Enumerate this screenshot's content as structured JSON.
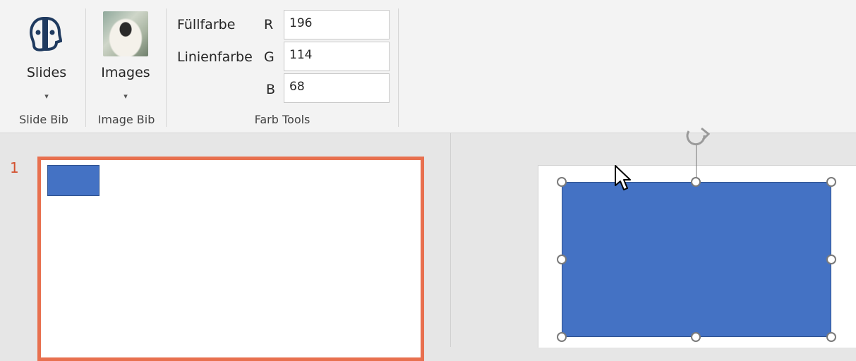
{
  "ribbon": {
    "slides_button": {
      "label": "Slides",
      "caret": "▾"
    },
    "images_button": {
      "label": "Images",
      "caret": "▾"
    },
    "groups": {
      "slide_bib": "Slide Bib",
      "image_bib": "Image Bib",
      "farb_tools": "Farb Tools"
    },
    "farb": {
      "fill_label": "Füllfarbe",
      "line_label": "Linienfarbe",
      "r_label": "R",
      "g_label": "G",
      "b_label": "B",
      "r_value": "196",
      "g_value": "114",
      "b_value": "68"
    }
  },
  "thumbnails": {
    "slide_number": "1"
  },
  "colors": {
    "shape_fill": "#4472c4",
    "shape_border": "#2f528f",
    "selection_accent": "#e8704f",
    "slide_number": "#d35230"
  }
}
